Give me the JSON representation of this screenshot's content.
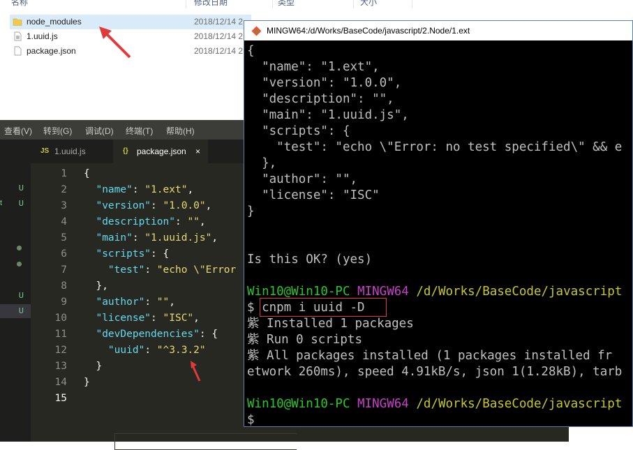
{
  "explorer": {
    "headers": [
      "名称",
      "修改日期",
      "类型",
      "大小"
    ],
    "files": [
      {
        "name": "node_modules",
        "date": "2018/12/14 2",
        "icon": "folder-icon"
      },
      {
        "name": "1.uuid.js",
        "date": "2018/12/14 2",
        "icon": "js-file-icon"
      },
      {
        "name": "package.json",
        "date": "2018/12/14 2",
        "icon": "json-file-icon"
      }
    ]
  },
  "editor": {
    "menu": [
      "查看(V)",
      "转到(G)",
      "调试(D)",
      "终端(T)",
      "帮助(H)"
    ],
    "tabs": [
      {
        "icon": "JS",
        "label": "1.uuid.js"
      },
      {
        "icon": "{}",
        "label": "package.json",
        "close": "×"
      }
    ],
    "sidebar_badges": [
      "U",
      "U",
      "U",
      "U"
    ],
    "sidebar_partial": "t",
    "line_numbers": [
      "1",
      "2",
      "3",
      "4",
      "5",
      "6",
      "7",
      "8",
      "9",
      "10",
      "11",
      "12",
      "13",
      "14",
      "15"
    ],
    "code": {
      "l1": "{",
      "l2k": "\"name\"",
      "l2v": "\"1.ext\"",
      "l3k": "\"version\"",
      "l3v": "\"1.0.0\"",
      "l4k": "\"description\"",
      "l4v": "\"\"",
      "l5k": "\"main\"",
      "l5v": "\"1.uuid.js\"",
      "l6k": "\"scripts\"",
      "l7k": "\"test\"",
      "l7v": "\"echo \\\"Error",
      "l8": "},",
      "l9k": "\"author\"",
      "l9v": "\"\"",
      "l10k": "\"license\"",
      "l10v": "\"ISC\"",
      "l11k": "\"devDependencies\"",
      "l12k": "\"uuid\"",
      "l12v": "\"^3.3.2\"",
      "l13": "}",
      "l14": "}"
    }
  },
  "terminal": {
    "title": "MINGW64:/d/Works/BaseCode/javascript/2.Node/1.ext",
    "lines": [
      "{",
      "  \"name\": \"1.ext\",",
      "  \"version\": \"1.0.0\",",
      "  \"description\": \"\",",
      "  \"main\": \"1.uuid.js\",",
      "  \"scripts\": {",
      "    \"test\": \"echo \\\"Error: no test specified\\\" && e",
      "  },",
      "  \"author\": \"\",",
      "  \"license\": \"ISC\"",
      "}",
      "",
      "",
      "Is this OK? (yes)"
    ],
    "prompt_user": "Win10@Win10-PC",
    "prompt_env": "MINGW64",
    "prompt_path": "/d/Works/BaseCode/javascript",
    "dollar": "$",
    "command": "cnpm i uuid -D",
    "out_prefix": "紫",
    "out1": " Installed 1 packages",
    "out2": " Run 0 scripts",
    "out3": " All packages installed (1 packages installed fr",
    "out4": "etwork 260ms), speed 4.91kB/s, json 1(1.28kB), tarb"
  }
}
